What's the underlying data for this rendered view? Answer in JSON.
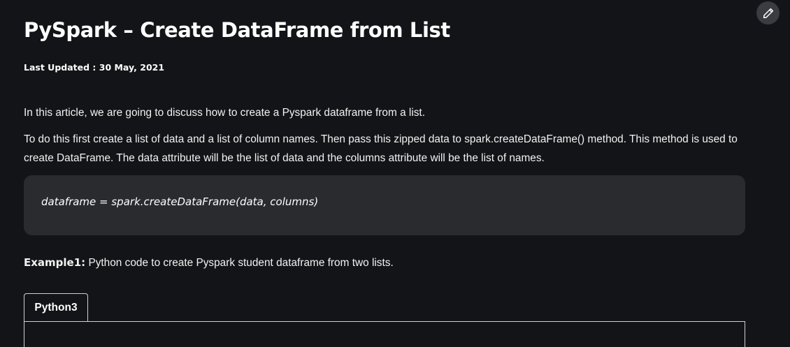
{
  "article": {
    "title": "PySpark – Create DataFrame from List",
    "last_updated": "Last Updated : 30 May, 2021",
    "intro": "In this article, we are going to discuss how to create a Pyspark dataframe from a list.",
    "description": "To do this first create a list of data and a list of column names. Then pass this zipped data to spark.createDataFrame() method. This method is used to create DataFrame. The data attribute will be the list of data and the columns attribute will be the list of names.",
    "syntax_code": "dataframe = spark.createDataFrame(data, columns)",
    "example_label": "Example1:",
    "example_text": " Python code to create Pyspark student dataframe from two lists."
  },
  "code_tabs": {
    "active_tab": "Python3"
  },
  "toolbar": {
    "edit_icon": "pencil-icon"
  }
}
